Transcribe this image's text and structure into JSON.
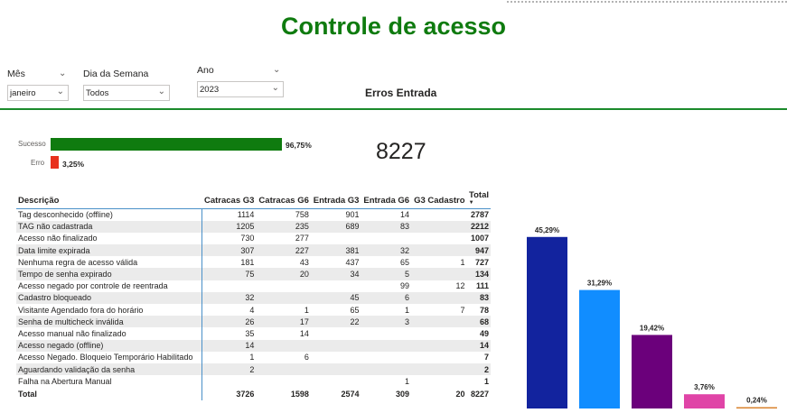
{
  "title": "Controle de acesso",
  "filters": {
    "mes": {
      "label": "Mês",
      "value": "janeiro"
    },
    "dia_semana": {
      "label": "Dia da Semana",
      "value": "Todos"
    },
    "ano": {
      "label": "Ano",
      "value": "2023"
    }
  },
  "visual_title": "Erros Entrada",
  "kpi_value": "8227",
  "success_bar": {
    "items": [
      {
        "label": "Sucesso",
        "value_text": "96,75%",
        "value": 96.75,
        "color": "#0f7b0f"
      },
      {
        "label": "Erro",
        "value_text": "3,25%",
        "value": 3.25,
        "color": "#e8311e"
      }
    ]
  },
  "table": {
    "headers": [
      "Descrição",
      "Catracas G3",
      "Catracas G6",
      "Entrada G3",
      "Entrada G6",
      "G3 Cadastro",
      "Total"
    ],
    "rows": [
      [
        "Tag desconhecido (offline)",
        "1114",
        "758",
        "901",
        "14",
        "",
        "2787"
      ],
      [
        "TAG não cadastrada",
        "1205",
        "235",
        "689",
        "83",
        "",
        "2212"
      ],
      [
        "Acesso não finalizado",
        "730",
        "277",
        "",
        "",
        "",
        "1007"
      ],
      [
        "Data limite expirada",
        "307",
        "227",
        "381",
        "32",
        "",
        "947"
      ],
      [
        "Nenhuma regra de acesso válida",
        "181",
        "43",
        "437",
        "65",
        "1",
        "727"
      ],
      [
        "Tempo de senha expirado",
        "75",
        "20",
        "34",
        "5",
        "",
        "134"
      ],
      [
        "Acesso negado por controle de reentrada",
        "",
        "",
        "",
        "99",
        "12",
        "111"
      ],
      [
        "Cadastro bloqueado",
        "32",
        "",
        "45",
        "6",
        "",
        "83"
      ],
      [
        "Visitante Agendado fora do horário",
        "4",
        "1",
        "65",
        "1",
        "7",
        "78"
      ],
      [
        "Senha de multicheck inválida",
        "26",
        "17",
        "22",
        "3",
        "",
        "68"
      ],
      [
        "Acesso manual não finalizado",
        "35",
        "14",
        "",
        "",
        "",
        "49"
      ],
      [
        "Acesso negado (offline)",
        "14",
        "",
        "",
        "",
        "",
        "14"
      ],
      [
        "Acesso Negado. Bloqueio Temporário Habilitado",
        "1",
        "6",
        "",
        "",
        "",
        "7"
      ],
      [
        "Aguardando validação da senha",
        "2",
        "",
        "",
        "",
        "",
        "2"
      ],
      [
        "Falha na Abertura Manual",
        "",
        "",
        "",
        "1",
        "",
        "1"
      ]
    ],
    "total_row": [
      "Total",
      "3726",
      "1598",
      "2574",
      "309",
      "20",
      "8227"
    ]
  },
  "chart_data": {
    "type": "bar",
    "values": [
      45.29,
      31.29,
      19.42,
      3.76,
      0.24
    ],
    "labels": [
      "45,29%",
      "31,29%",
      "19,42%",
      "3,76%",
      "0,24%"
    ],
    "colors": [
      "#12239e",
      "#118dff",
      "#6b007b",
      "#e044a7",
      "#d9832f"
    ],
    "ylim": [
      0,
      50
    ],
    "grid": false
  }
}
